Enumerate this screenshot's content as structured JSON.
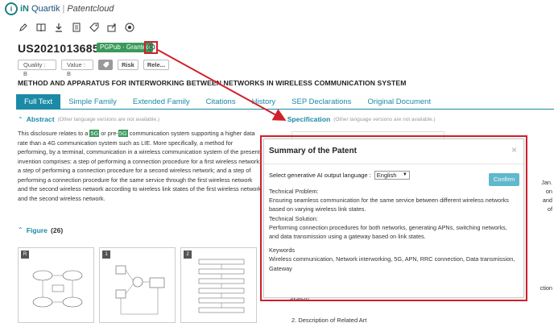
{
  "app": {
    "logo_in": "iN",
    "logo_quartik": "Quartik",
    "logo_separator": "|",
    "logo_product": "Patentcloud"
  },
  "toolbar": {
    "icons": [
      "pencil-icon",
      "book-icon",
      "download-icon",
      "document-icon",
      "tag-icon",
      "export-icon",
      "eye-settings-icon"
    ]
  },
  "patent": {
    "number": "US20210136859A1",
    "status": "PGPub · Granted",
    "quality": "Quality : B",
    "value": "Value : B",
    "risk": "Risk",
    "related": "Rele...",
    "title": "METHOD AND APPARATUS FOR INTERWORKING BETWEEN NETWORKS IN WIRELESS COMMUNICATION SYSTEM"
  },
  "tabs": [
    {
      "label": "Full Text",
      "active": true
    },
    {
      "label": "Simple Family",
      "active": false
    },
    {
      "label": "Extended Family",
      "active": false
    },
    {
      "label": "Citations",
      "active": false
    },
    {
      "label": "History",
      "active": false
    },
    {
      "label": "SEP Declarations",
      "active": false
    },
    {
      "label": "Original Document",
      "active": false
    }
  ],
  "abstract": {
    "heading": "Abstract",
    "note": "(Other language versions are not available.)",
    "p1": "This disclosure relates to a ",
    "hl1": "5G",
    "p2": " or pre-",
    "hl2": "5G",
    "p3": " communication system supporting a higher data rate than a 4G communication system such as LIE. More specifically, a method for performing, by a terminal, communication in a wireless communication system of the present invention comprises: a step of performing a connection procedure for a first wireless network; a step of performing a connection procedure for a second wireless network; and a step of performing a connection procedure for the same service through the first wireless network and the second wireless network according to wireless link states of the first wireless network and the second wireless network."
  },
  "specification": {
    "heading": "Specification",
    "note": "(Other language versions are not available.)",
    "right_fragments": [
      "Jan.",
      "on",
      "and",
      "of",
      "ction"
    ],
    "bottom_line": "system",
    "bottom_line2": "2. Description of Related Art"
  },
  "figure": {
    "heading": "Figure",
    "count": "(26)",
    "labels": [
      "R",
      "1",
      "2"
    ]
  },
  "summary_modal": {
    "title": "Summary of the Patent",
    "close": "×",
    "language_label": "Select generative AI output language :",
    "language_value": "English",
    "confirm": "Confirm",
    "problem_heading": "Technical Problem:",
    "problem_text": "Ensuring seamless communication for the same service between different wireless networks based on varying wireless link states.",
    "solution_heading": "Technical Solution:",
    "solution_text": "Performing connection procedures for both networks, generating APNs, switching networks, and data transmission using a gateway based on link states.",
    "keywords_heading": "Keywords",
    "keywords_text": "Wireless communication, Network interworking, 5G, APN, RRC connection, Data transmission, Gateway"
  },
  "colors": {
    "teal": "#1b8aa6",
    "green": "#3a9a5b",
    "annotation_red": "#d0202a"
  }
}
